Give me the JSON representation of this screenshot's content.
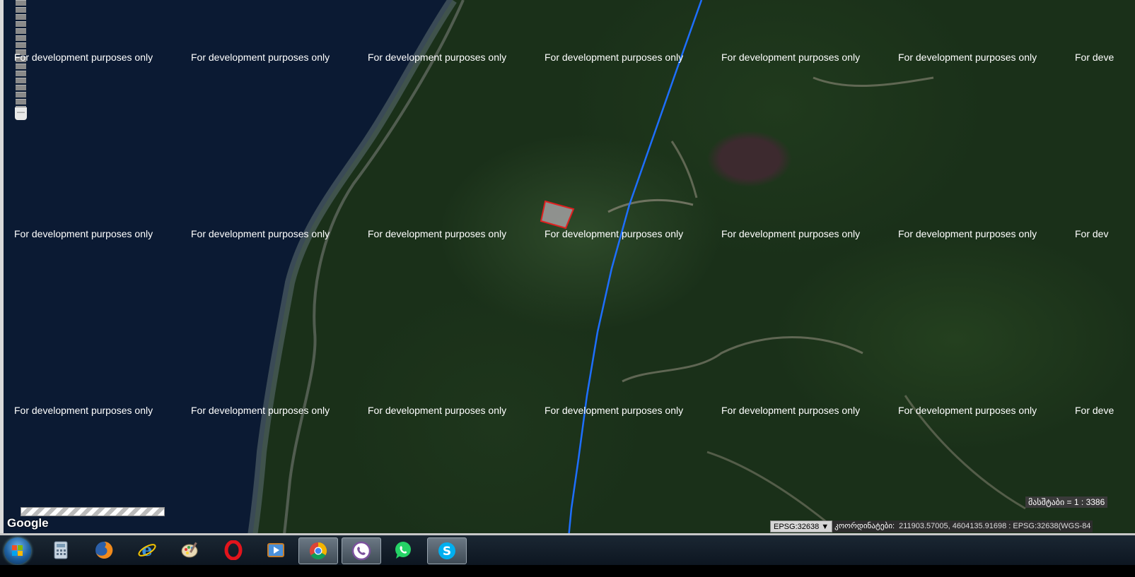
{
  "map": {
    "watermark_text": "For development purposes only",
    "watermark_rows": [
      [
        "For development purposes only",
        "For development purposes only",
        "For development purposes only",
        "For development purposes only",
        "For development purposes only",
        "For development purposes only",
        "For deve"
      ],
      [
        "For development purposes only",
        "For development purposes only",
        "For development purposes only",
        "For development purposes only",
        "For development purposes only",
        "For development purposes only",
        "For dev"
      ],
      [
        "For development purposes only",
        "For development purposes only",
        "For development purposes only",
        "For development purposes only",
        "For development purposes only",
        "For development purposes only",
        "For deve"
      ]
    ],
    "attribution": "Google",
    "scale_text": "მასშტაბი = 1 : 3386",
    "projection_select": "EPSG:32638",
    "coordinates_label": "კოორდინატები:",
    "coordinates_value": "211903.57005, 4604135.91698 : EPSG:32638(WGS-84",
    "colors": {
      "line": "#1e6fff",
      "parcel_fill": "#9a9a9a",
      "parcel_stroke": "#e02020",
      "sea": "#0b1a33"
    }
  },
  "taskbar": {
    "icons": [
      "windows-start-icon",
      "calculator-icon",
      "firefox-icon",
      "internet-explorer-icon",
      "paint-icon",
      "opera-icon",
      "media-player-icon",
      "chrome-icon",
      "viber-icon",
      "whatsapp-icon",
      "skype-icon"
    ]
  }
}
